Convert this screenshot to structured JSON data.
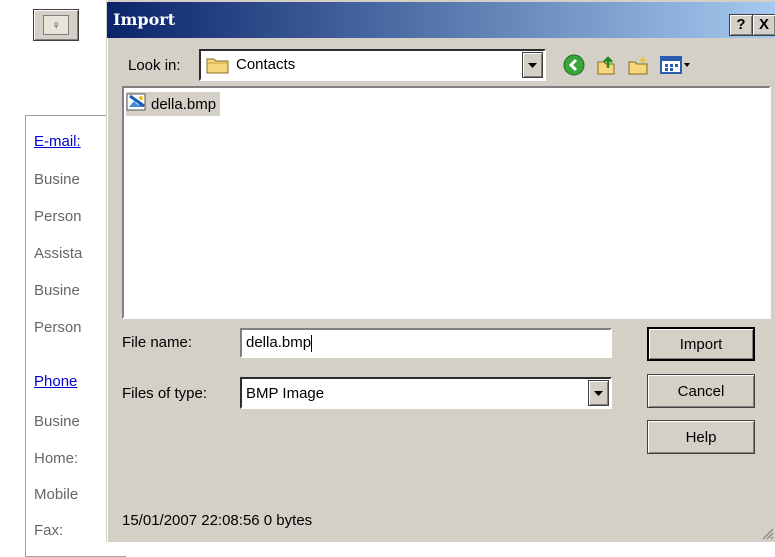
{
  "background_form": {
    "section_email": "E-mail:",
    "email_lines": [
      "Busine",
      "Person",
      "Assista",
      "Busine",
      "Person"
    ],
    "section_phone": "Phone",
    "phone_lines": [
      "Busine",
      "Home:",
      "Mobile",
      "Fax:"
    ]
  },
  "dialog": {
    "title": "Import",
    "help_glyph": "?",
    "close_glyph": "X",
    "look_in_label": "Look in:",
    "look_in_value": "Contacts",
    "toolbar_icons": [
      "back-icon",
      "up-folder-icon",
      "new-folder-icon",
      "view-menu-icon"
    ],
    "files": [
      {
        "name": "della.bmp",
        "icon": "bmp-image-icon",
        "selected": true
      }
    ],
    "file_name_label": "File name:",
    "file_name_value": "della.bmp",
    "files_of_type_label": "Files of type:",
    "files_of_type_value": "BMP Image",
    "import_button": "Import",
    "cancel_button": "Cancel",
    "help_button": "Help",
    "status": "15/01/2007 22:08:56 0 bytes"
  },
  "colors": {
    "title_start": "#0a246a",
    "title_end": "#a6caf0",
    "face": "#d4d0c8",
    "link": "#0000cc"
  }
}
